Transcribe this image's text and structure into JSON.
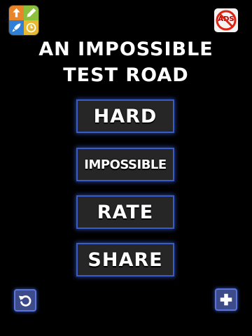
{
  "title": {
    "line1": "AN IMPOSSIBLE",
    "line2": "TEST ROAD"
  },
  "menu": {
    "hard_label": "HARD",
    "impossible_label": "IMPOSSIBLE",
    "rate_label": "RATE",
    "share_label": "SHARE"
  },
  "icons": {
    "more_apps": "more-apps-icon",
    "remove_ads": "no-ads-icon",
    "back": "back-arrow-icon",
    "more": "plus-icon"
  },
  "remove_ads_text": "ADS",
  "colors": {
    "background": "#000000",
    "button_fill": "#262626",
    "button_border": "#3a5cc8",
    "text": "#ffffff"
  }
}
